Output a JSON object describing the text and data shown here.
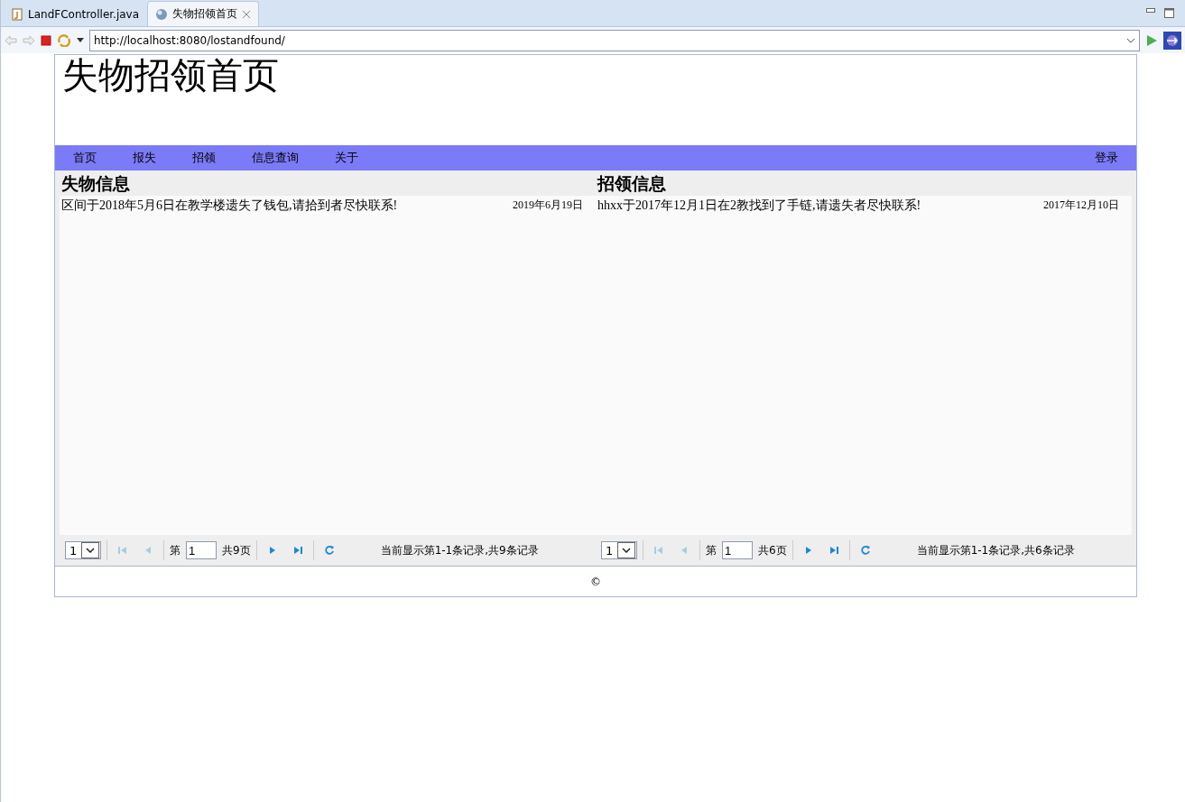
{
  "editor_tabs": [
    {
      "label": "LandFController.java",
      "kind": "java",
      "selected": false
    },
    {
      "label": "失物招领首页",
      "kind": "web",
      "selected": true
    }
  ],
  "browser": {
    "url": "http://localhost:8080/lostandfound/"
  },
  "page": {
    "title": "失物招领首页",
    "nav": [
      "首页",
      "报失",
      "招领",
      "信息查询",
      "关于"
    ],
    "login": "登录",
    "panels": [
      {
        "title": "失物信息",
        "items": [
          {
            "text": "区间于2018年5月6日在教学楼遗失了钱包,请拾到者尽快联系!",
            "date": "2019年6月19日"
          }
        ],
        "pager": {
          "page_size": "1",
          "page_label": "第",
          "page": "1",
          "total_pages": "共9页",
          "summary": "当前显示第1-1条记录,共9条记录",
          "buttons": [
            {
              "kind": "first",
              "disabled": true
            },
            {
              "kind": "prev",
              "disabled": true
            },
            {
              "kind": "next",
              "disabled": false
            },
            {
              "kind": "last",
              "disabled": false
            }
          ]
        }
      },
      {
        "title": "招领信息",
        "items": [
          {
            "text": "hhxx于2017年12月1日在2教找到了手链,请遗失者尽快联系!",
            "date": "2017年12月10日"
          }
        ],
        "pager": {
          "page_size": "1",
          "page_label": "第",
          "page": "1",
          "total_pages": "共6页",
          "summary": "当前显示第1-1条记录,共6条记录",
          "buttons": [
            {
              "kind": "first",
              "disabled": true
            },
            {
              "kind": "prev",
              "disabled": true
            },
            {
              "kind": "next",
              "disabled": false
            },
            {
              "kind": "last",
              "disabled": false
            }
          ]
        }
      }
    ],
    "footer": "©"
  }
}
